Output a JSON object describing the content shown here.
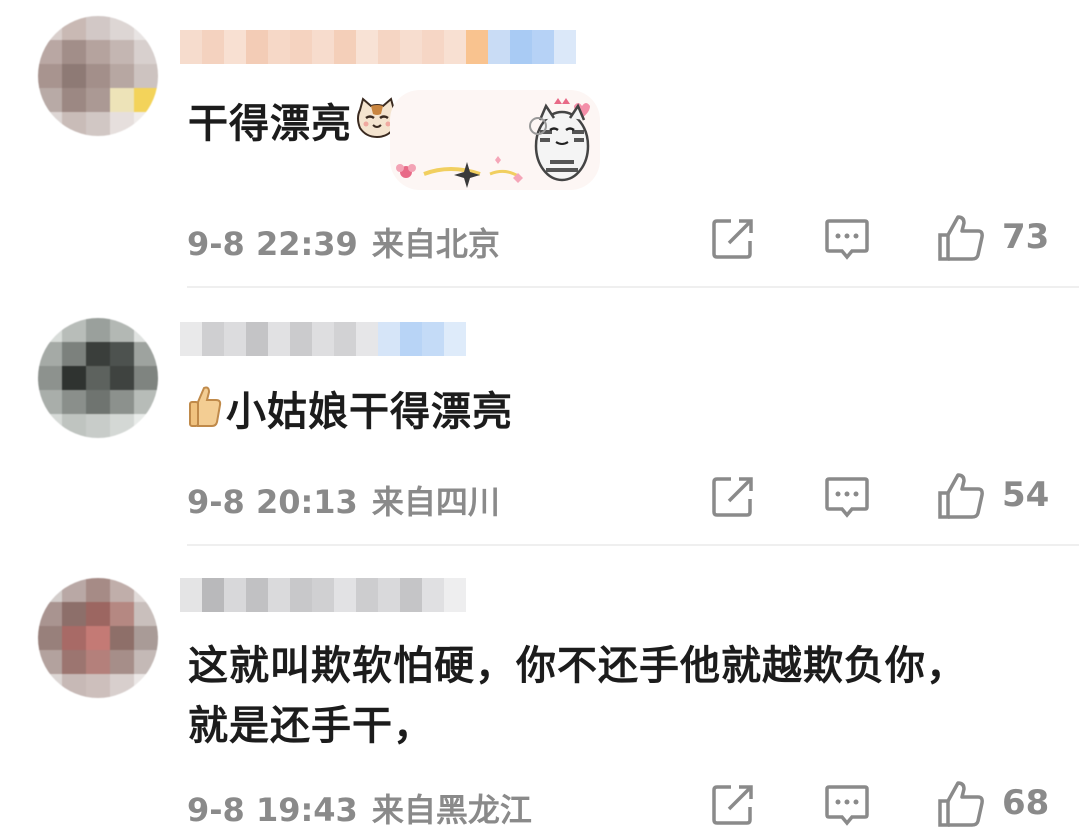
{
  "comments": [
    {
      "text": "干得漂亮",
      "time": "9-8 22:39",
      "location": "来自北京",
      "likes": "73",
      "text_emoji": "cat-face-icon",
      "sticker": "cat-sticker"
    },
    {
      "text": "小姑娘干得漂亮",
      "time": "9-8 20:13",
      "location": "来自四川",
      "likes": "54",
      "text_emoji": "thumbs-up-icon"
    },
    {
      "text_line1": "这就叫欺软怕硬，你不还手他就越欺负你，",
      "text_line2": "就是还手干，",
      "time": "9-8 19:43",
      "location": "来自黑龙江",
      "likes": "68"
    }
  ],
  "icons": {
    "share": "share-icon",
    "comment": "comment-icon",
    "like": "like-thumb-icon"
  },
  "colors": {
    "meta": "#8a8a8a",
    "text": "#1c1c1c",
    "divider": "#efefef"
  }
}
